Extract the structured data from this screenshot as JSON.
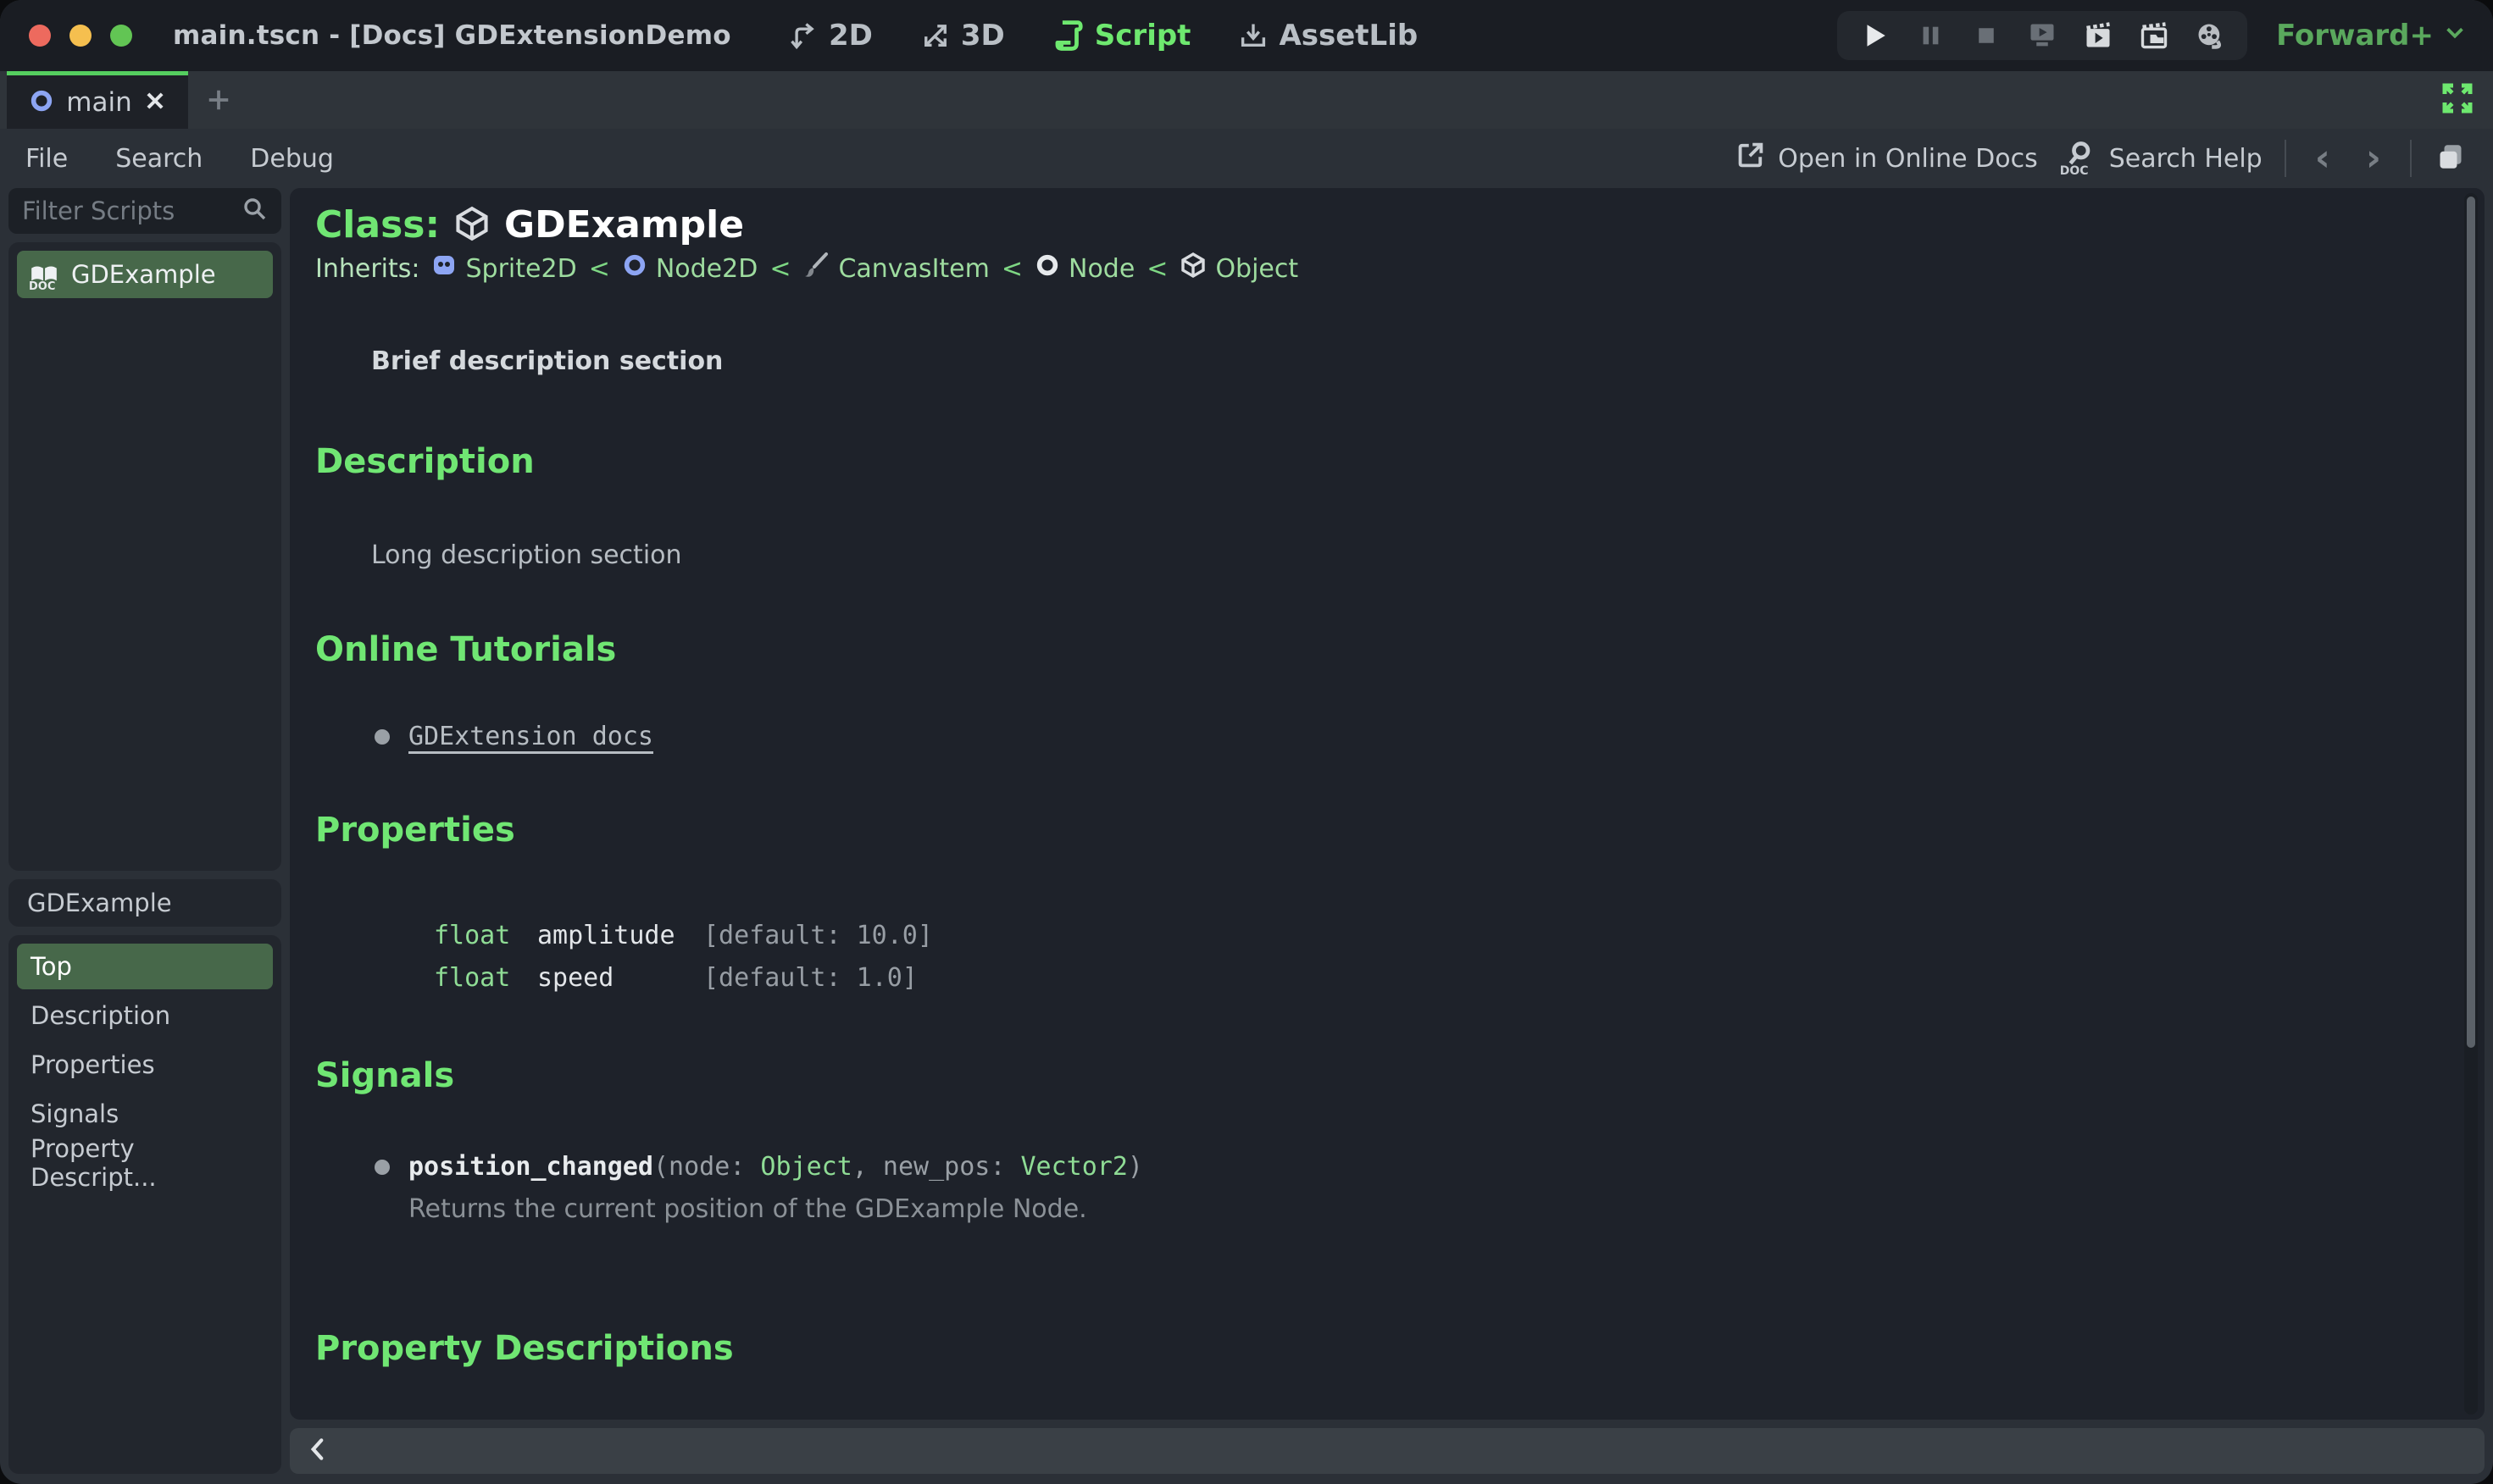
{
  "window": {
    "title": "main.tscn - [Docs] GDExtensionDemo"
  },
  "workspaces": {
    "two_d": "2D",
    "three_d": "3D",
    "script": "Script",
    "assetlib": "AssetLib"
  },
  "toolbar": {
    "renderer": "Forward+"
  },
  "scene_tabs": {
    "main_label": "main"
  },
  "menus": {
    "file": "File",
    "search": "Search",
    "debug": "Debug",
    "open_online_docs": "Open in Online Docs",
    "search_help": "Search Help"
  },
  "sidebar": {
    "filter_placeholder": "Filter Scripts",
    "scripts": [
      "GDExample"
    ],
    "member_header": "GDExample",
    "members": [
      "Top",
      "Description",
      "Properties",
      "Signals",
      "Property Descript..."
    ]
  },
  "doc": {
    "class_label": "Class:",
    "class_name": "GDExample",
    "inherits_label": "Inherits:",
    "sep": "<",
    "chain": [
      "Sprite2D",
      "Node2D",
      "CanvasItem",
      "Node",
      "Object"
    ],
    "brief": "Brief description section",
    "description_title": "Description",
    "description_body": "Long description section",
    "tutorials_title": "Online Tutorials",
    "tutorial_link": "GDExtension docs",
    "properties_title": "Properties",
    "properties": [
      {
        "type": "float",
        "name": "amplitude",
        "default": "[default: 10.0]"
      },
      {
        "type": "float",
        "name": "speed",
        "default": "[default: 1.0]"
      }
    ],
    "signals_title": "Signals",
    "signal": {
      "name": "position_changed",
      "p1": "(node: ",
      "t1": "Object",
      "p2": ", new_pos: ",
      "t2": "Vector2",
      "p3": ")",
      "desc": "Returns the current position of the GDExample Node."
    },
    "property_descriptions_title": "Property Descriptions"
  },
  "icons": {
    "doc_word": "DOC"
  },
  "colors": {
    "accent_green": "#70e673",
    "link_green": "#9edc9f",
    "type_green": "#8fdc95",
    "selected_row_green": "#47684a",
    "tab_border_green": "#55ce5f",
    "renderer_green": "#5aa85d",
    "node2d_blue": "#8da5f3",
    "panel_bg": "#22262d",
    "doc_bg": "#1e222a",
    "chrome_bg": "#2b3037",
    "titlebar_bg": "#1a1d23"
  }
}
